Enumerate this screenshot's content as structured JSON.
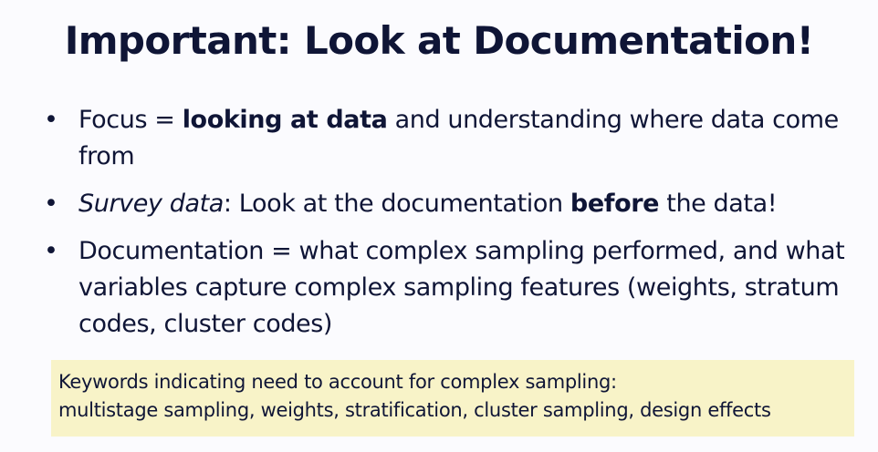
{
  "slide": {
    "title": "Important: Look at Documentation!",
    "bullet_glyph": "•",
    "bullets": [
      {
        "parts": [
          {
            "text": "Focus = ",
            "style": "normal"
          },
          {
            "text": "looking at data",
            "style": "bold"
          },
          {
            "text": " and understanding where data come from",
            "style": "normal"
          }
        ]
      },
      {
        "parts": [
          {
            "text": "Survey data",
            "style": "italic"
          },
          {
            "text": ": Look at the documentation ",
            "style": "normal"
          },
          {
            "text": "before",
            "style": "bold"
          },
          {
            "text": " the data!",
            "style": "normal"
          }
        ]
      },
      {
        "parts": [
          {
            "text": "Documentation = what complex sampling performed, and what variables capture complex sampling features (weights, stratum codes, cluster codes)",
            "style": "normal"
          }
        ]
      }
    ],
    "keywords_box": {
      "line1": "Keywords indicating need to account for complex sampling:",
      "line2": "multistage sampling, weights, stratification, cluster sampling, design effects",
      "background_color": "#f8f3c8"
    },
    "text_color": "#0f1536"
  }
}
